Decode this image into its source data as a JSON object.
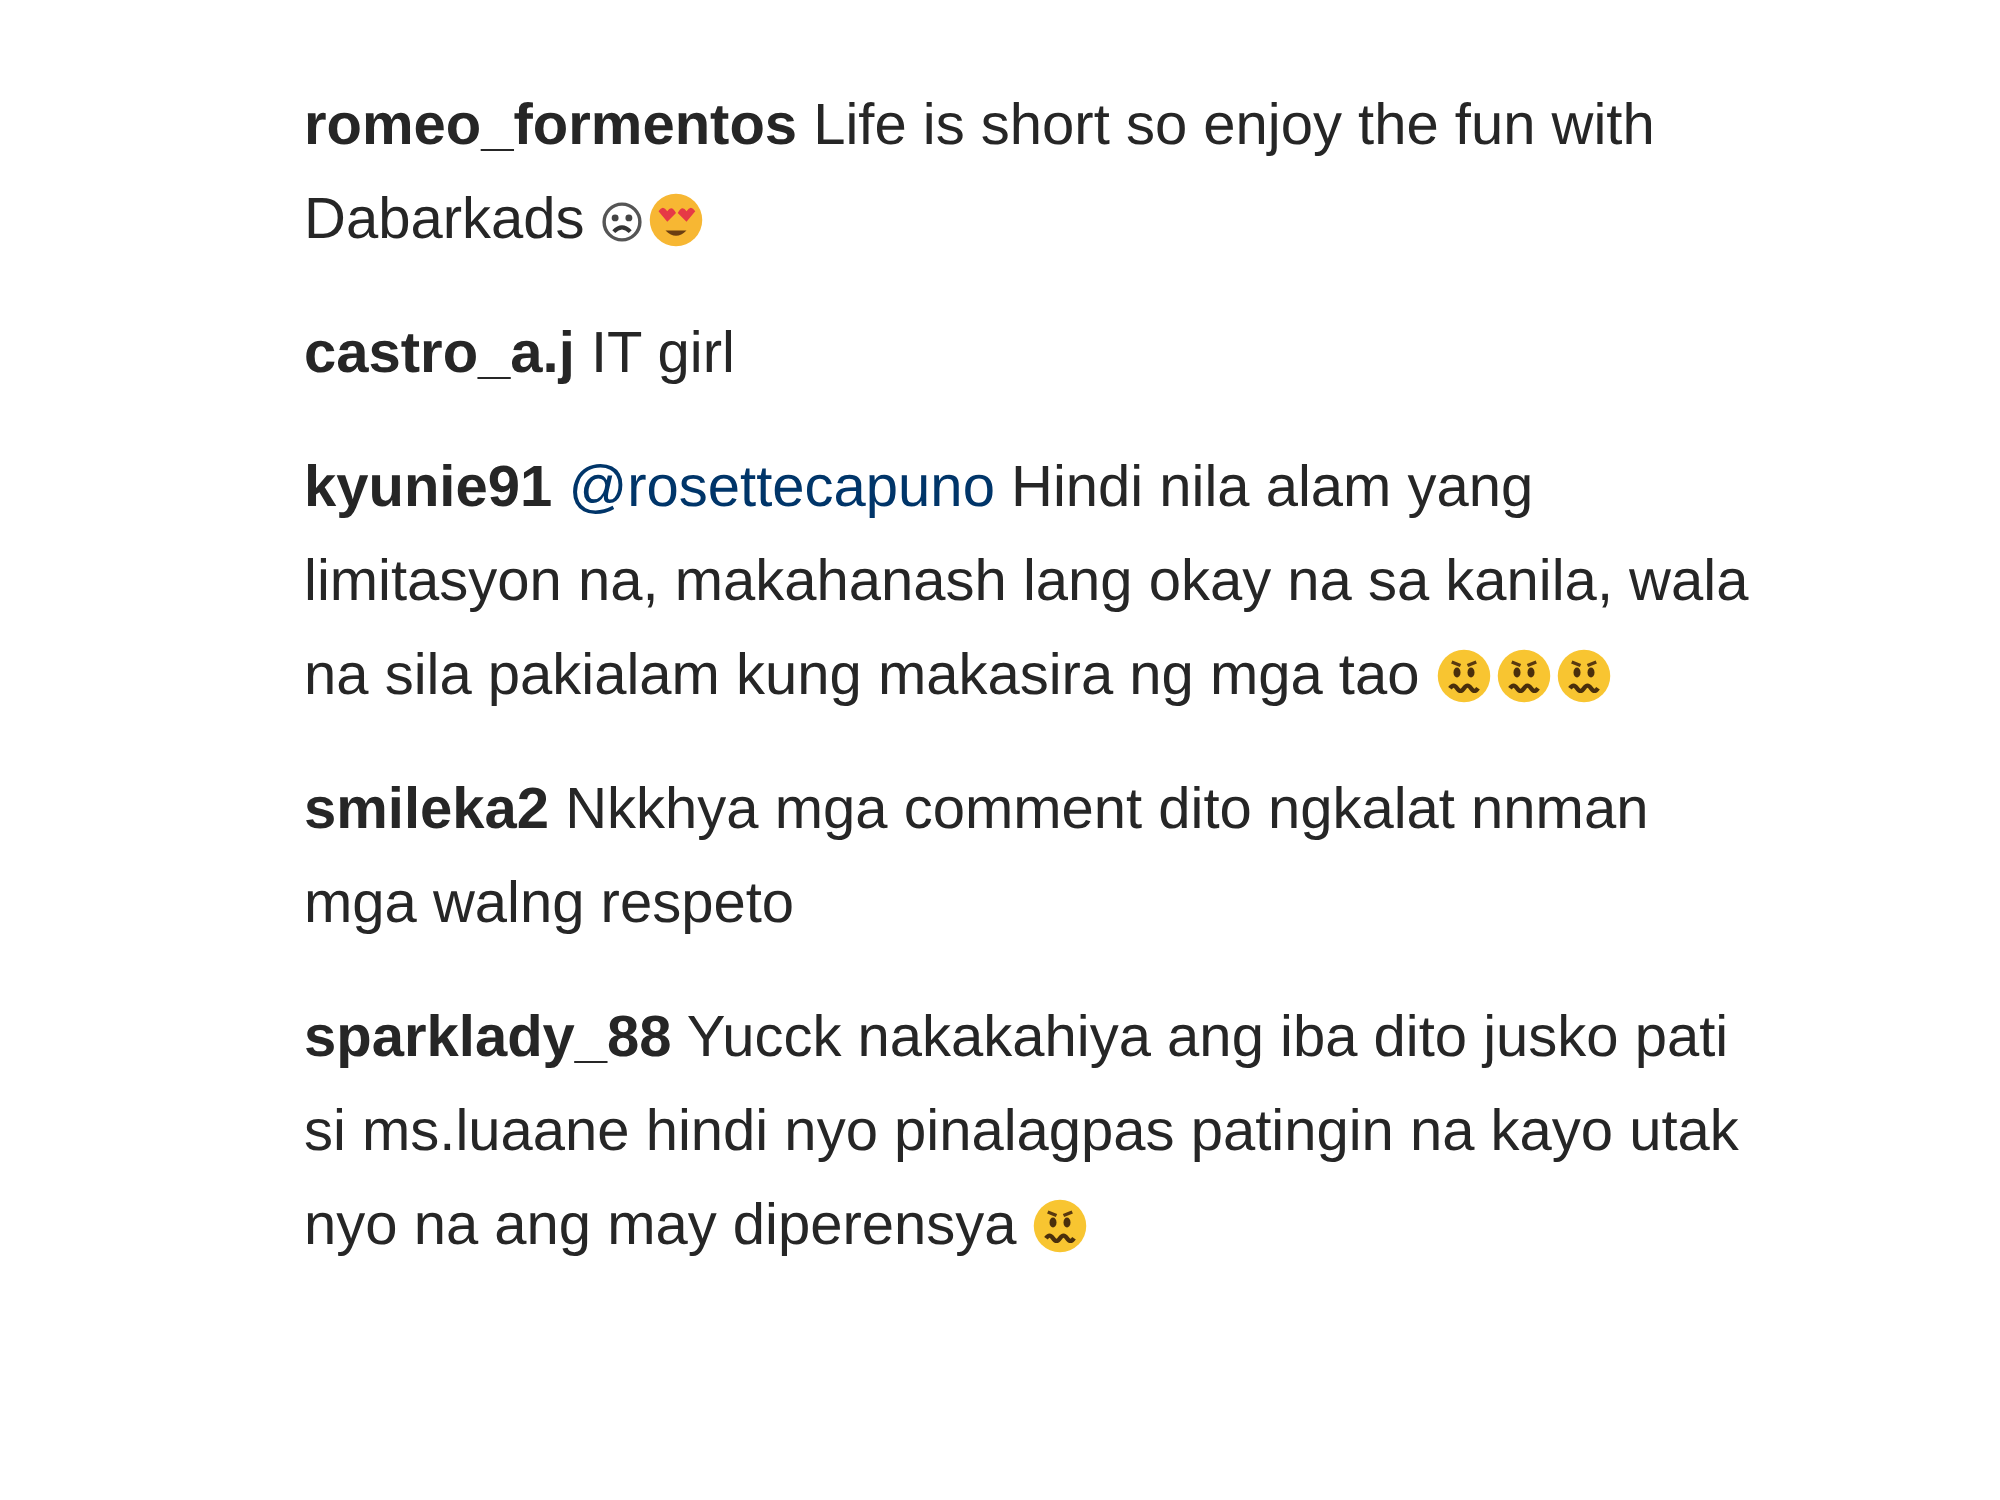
{
  "comments": [
    {
      "username": "romeo_formentos",
      "text": "Life is short so enjoy the fun with Dabarkads",
      "emojis": [
        {
          "kind": "outline-face"
        },
        {
          "kind": "heart-eyes"
        }
      ]
    },
    {
      "username": "castro_a.j",
      "text": "IT girl"
    },
    {
      "username": "kyunie91",
      "mention": "@rosettecapuno",
      "text": "Hindi nila alam yang limitasyon na, makahanash lang okay na sa kanila, wala na sila pakialam kung makasira ng mga tao",
      "emojis": [
        {
          "kind": "worried"
        },
        {
          "kind": "worried"
        },
        {
          "kind": "worried"
        }
      ]
    },
    {
      "username": "smileka2",
      "text": "Nkkhya mga comment dito ngkalat nnman mga walng respeto"
    },
    {
      "username": "sparklady_88",
      "text": "Yucck nakakahiya ang iba dito jusko pati si ms.luaane hindi nyo pinalagpas patingin na kayo utak nyo na ang may diperensya",
      "emojis": [
        {
          "kind": "worried"
        }
      ]
    }
  ]
}
